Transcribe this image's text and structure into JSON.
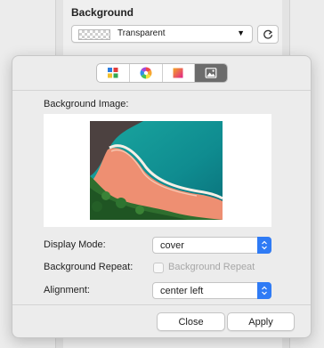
{
  "inspector": {
    "section_title": "Background",
    "background_select": {
      "value": "Transparent",
      "caret_icon": "caret-down-icon"
    },
    "reset_icon": "reset-icon"
  },
  "popover": {
    "tabs": [
      {
        "icon": "color-palette-grid-icon",
        "active": false
      },
      {
        "icon": "color-wheel-icon",
        "active": false
      },
      {
        "icon": "gradient-icon",
        "active": false
      },
      {
        "icon": "image-icon",
        "active": true
      }
    ],
    "background_image_label": "Background Image:",
    "display_mode": {
      "label": "Display Mode:",
      "value": "cover"
    },
    "background_repeat": {
      "label": "Background Repeat:",
      "checkbox_label": "Background Repeat",
      "checked": false,
      "enabled": false
    },
    "alignment": {
      "label": "Alignment:",
      "value": "center left"
    },
    "close_label": "Close",
    "apply_label": "Apply"
  },
  "colors": {
    "accent": "#2f7bf5",
    "active_tab": "#6c6c6c",
    "disabled_text": "#a7a7a7"
  }
}
